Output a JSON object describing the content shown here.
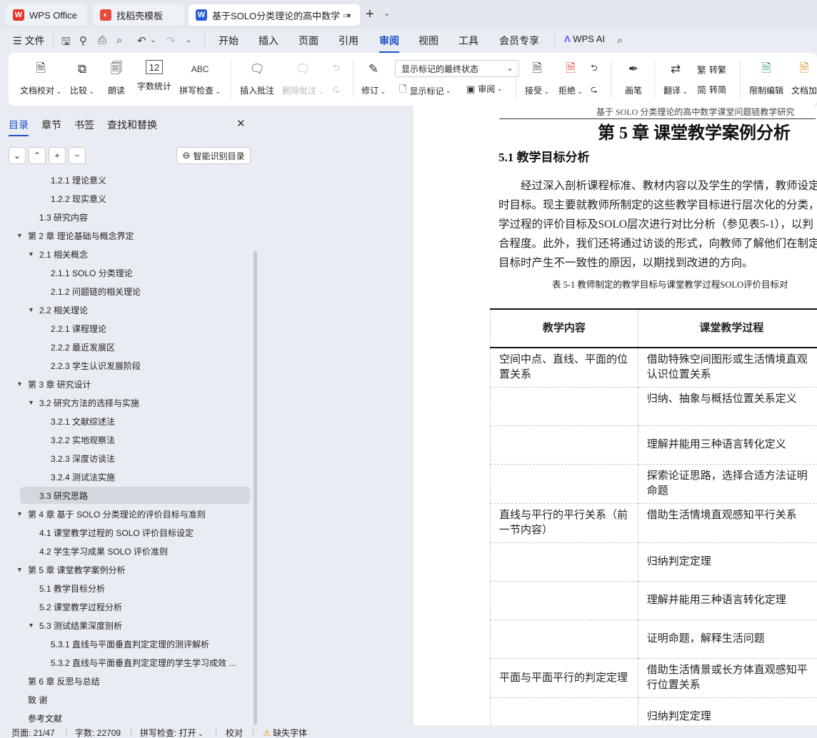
{
  "tabs": [
    {
      "label": "WPS Office",
      "icon": "wps-logo-icon"
    },
    {
      "label": "找稻壳模板",
      "icon": "docer-icon"
    },
    {
      "label": "基于SOLO分类理论的高中数学",
      "icon": "writer-doc-icon",
      "active": true
    }
  ],
  "menu": {
    "file": "文件",
    "items": [
      "开始",
      "插入",
      "页面",
      "引用",
      "审阅",
      "视图",
      "工具",
      "会员专享"
    ],
    "selected": "审阅",
    "wps_ai": "WPS AI"
  },
  "ribbon": {
    "doc_proof": "文档校对",
    "compare": "比较",
    "read_aloud": "朗读",
    "word_count": "字数统计",
    "spell_check": "拼写检查",
    "insert_comment": "插入批注",
    "delete_comment": "删除批注",
    "track_changes": "修订",
    "markup_mode": "显示标记的最终状态",
    "show_markup": "显示标记",
    "review": "审阅",
    "accept": "接受",
    "reject": "拒绝",
    "pen": "画笔",
    "translate": "翻译",
    "to_traditional": "转繁",
    "to_simplified": "转简",
    "restrict_edit": "限制编辑",
    "doc_encrypt": "文档加"
  },
  "sidebar": {
    "tabs": [
      "目录",
      "章节",
      "书签",
      "查找和替换"
    ],
    "ai_toc": "智能识别目录",
    "toc": [
      {
        "text": "1.2.1  理论意义",
        "level": 3
      },
      {
        "text": "1.2.2  现实意义",
        "level": 3
      },
      {
        "text": "1.3  研究内容",
        "level": 2
      },
      {
        "text": "第 2 章  理论基础与概念界定",
        "level": 1,
        "expanded": true
      },
      {
        "text": "2.1  相关概念",
        "level": 2,
        "expanded": true
      },
      {
        "text": "2.1.1 SOLO 分类理论",
        "level": 3
      },
      {
        "text": "2.1.2  问题链的相关理论",
        "level": 3
      },
      {
        "text": "2.2  相关理论",
        "level": 2,
        "expanded": true
      },
      {
        "text": "2.2.1  课程理论",
        "level": 3
      },
      {
        "text": "2.2.2  最近发展区",
        "level": 3
      },
      {
        "text": "2.2.3  学生认识发展阶段",
        "level": 3
      },
      {
        "text": "第 3 章  研究设计",
        "level": 1,
        "expanded": true
      },
      {
        "text": "3.2  研究方法的选择与实施",
        "level": 2,
        "expanded": true
      },
      {
        "text": "3.2.1  文献综述法",
        "level": 3
      },
      {
        "text": "3.2.2  实地观察法",
        "level": 3
      },
      {
        "text": "3.2.3  深度访谈法",
        "level": 3
      },
      {
        "text": "3.2.4  测试法实施",
        "level": 3
      },
      {
        "text": "3.3  研究思路",
        "level": 2,
        "selected": true
      },
      {
        "text": "第 4 章  基于 SOLO 分类理论的评价目标与准则",
        "level": 1,
        "expanded": true
      },
      {
        "text": "4.1  课堂教学过程的 SOLO 评价目标设定",
        "level": 2
      },
      {
        "text": "4.2  学生学习成果 SOLO 评价准则",
        "level": 2
      },
      {
        "text": "第 5 章  课堂教学案例分析",
        "level": 1,
        "expanded": true
      },
      {
        "text": "5.1  教学目标分析",
        "level": 2
      },
      {
        "text": "5.2  课堂教学过程分析",
        "level": 2
      },
      {
        "text": "5.3  测试结果深度剖析",
        "level": 2,
        "expanded": true
      },
      {
        "text": "5.3.1  直线与平面垂直判定定理的测评解析",
        "level": 3
      },
      {
        "text": "5.3.2  直线与平面垂直判定定理的学生学习成效 ...",
        "level": 3
      },
      {
        "text": "第 6 章  反思与总结",
        "level": 1
      },
      {
        "text": "致   谢",
        "level": 1
      },
      {
        "text": "参考文献",
        "level": 1
      }
    ]
  },
  "document": {
    "running_head": "基于 SOLO 分类理论的高中数学课堂问题链教学研究",
    "chapter_title": "第 5 章  课堂教学案例分析",
    "section_title": "5.1  教学目标分析",
    "paragraph_lines": [
      "经过深入剖析课程标准、教材内容以及学生的学情，教师设定",
      "时目标。现主要就教师所制定的这些教学目标进行层次化的分类，",
      "学过程的评价目标及SOLO层次进行对比分析（参见表5-1），以判",
      "合程度。此外，我们还将通过访谈的形式，向教师了解他们在制定",
      "目标时产生不一致性的原因，以期找到改进的方向。"
    ],
    "table_caption": "表  5-1  教师制定的教学目标与课堂教学过程SOLO评价目标对",
    "table": {
      "headers": [
        "教学内容",
        "课堂教学过程"
      ],
      "rows": [
        [
          "空间中点、直线、平面的位置关系",
          "借助特殊空间图形或生活情境直观认识位置关系"
        ],
        [
          "",
          "归纳、抽象与概括位置关系定义"
        ],
        [
          "",
          "理解并能用三种语言转化定义"
        ],
        [
          "",
          "探索论证思路，选择合适方法证明命题"
        ],
        [
          "直线与平行的平行关系（前一节内容）",
          "借助生活情境直观感知平行关系"
        ],
        [
          "",
          "归纳判定定理"
        ],
        [
          "",
          "理解并能用三种语言转化定理"
        ],
        [
          "",
          "证明命题，解释生活问题"
        ],
        [
          "平面与平面平行的判定定理",
          "借助生活情景或长方体直观感知平行位置关系"
        ],
        [
          "",
          "归纳判定定理"
        ]
      ]
    }
  },
  "status": {
    "page": "页面: 21/47",
    "words": "字数: 22709",
    "spell": "拼写检查: 打开",
    "proof": "校对",
    "missing_font": "缺失字体"
  }
}
